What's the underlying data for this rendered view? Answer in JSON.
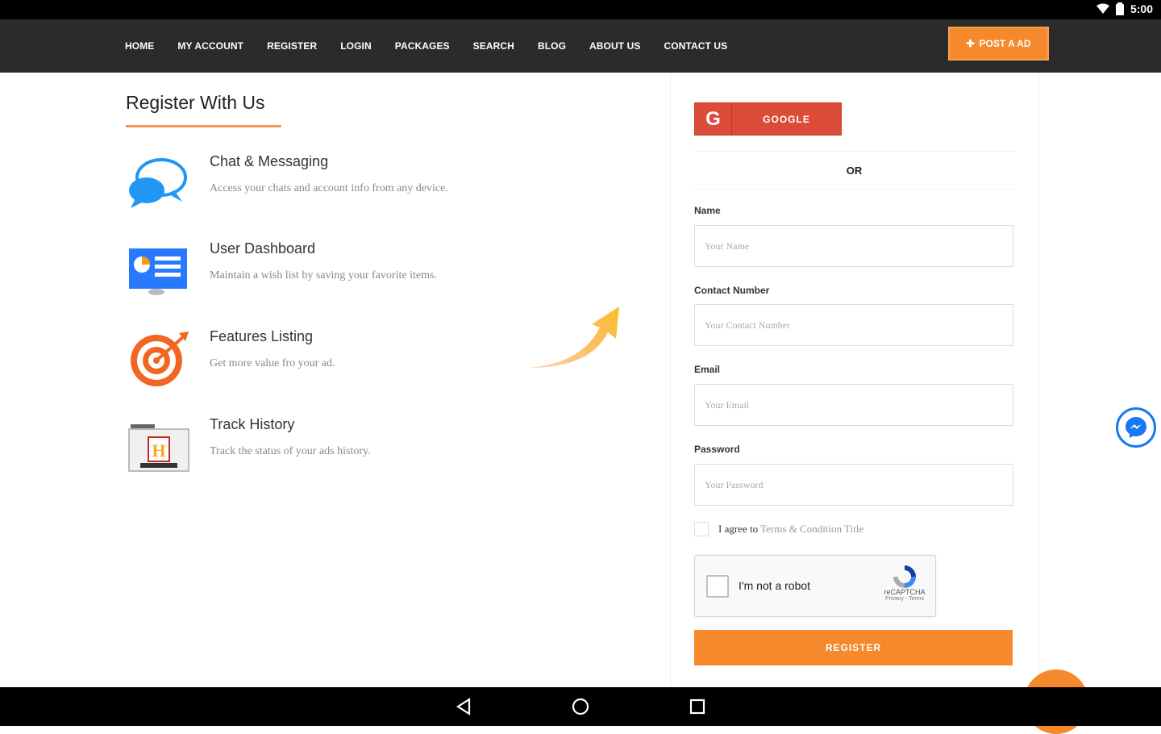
{
  "status": {
    "time": "5:00"
  },
  "nav": {
    "items": [
      "HOME",
      "MY ACCOUNT",
      "REGISTER",
      "LOGIN",
      "PACKAGES",
      "SEARCH",
      "BLOG",
      "ABOUT US",
      "CONTACT US"
    ],
    "post_label": "POST A AD"
  },
  "register": {
    "title": "Register With Us",
    "features": [
      {
        "title": "Chat & Messaging",
        "desc": "Access your chats and account info from any device."
      },
      {
        "title": "User Dashboard",
        "desc": "Maintain a wish list by saving your favorite items."
      },
      {
        "title": "Features Listing",
        "desc": "Get more value fro your ad."
      },
      {
        "title": "Track History",
        "desc": "Track the status of your ads history."
      }
    ]
  },
  "form": {
    "google_label": "GOOGLE",
    "or": "OR",
    "name_label": "Name",
    "name_placeholder": "Your Name",
    "contact_label": "Contact Number",
    "contact_placeholder": "Your Contact Number",
    "email_label": "Email",
    "email_placeholder": "Your Email",
    "password_label": "Password",
    "password_placeholder": "Your Password",
    "agree_text": "I agree to",
    "agree_link": "Terms & Condition Title",
    "captcha_text": "I'm not a robot",
    "captcha_brand": "reCAPTCHA",
    "captcha_links": "Privacy - Terms",
    "register_label": "REGISTER"
  },
  "colors": {
    "accent": "#f5892c",
    "google": "#dd4b39",
    "nav_bg": "#2b2b2b"
  }
}
